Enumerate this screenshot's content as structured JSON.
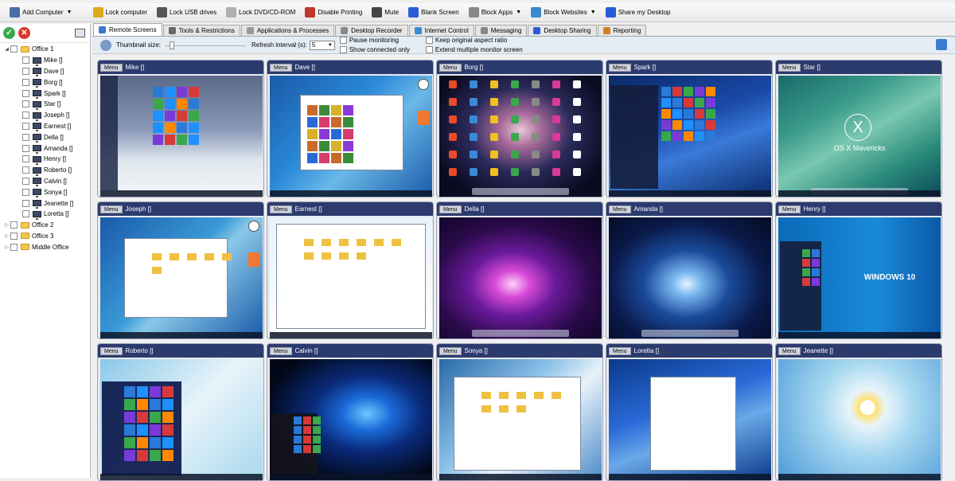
{
  "toolbar": {
    "items": [
      {
        "label": "Add Computer",
        "icon": "add-computer-icon",
        "color": "#4a6ea8"
      },
      {
        "label": "Lock computer",
        "icon": "lock-icon",
        "color": "#e0a820"
      },
      {
        "label": "Lock USB drives",
        "icon": "usb-icon",
        "color": "#555555"
      },
      {
        "label": "Lock DVD/CD-ROM",
        "icon": "dvd-icon",
        "color": "#b0b0b0"
      },
      {
        "label": "Disable Printing",
        "icon": "printer-icon",
        "color": "#c0392b"
      },
      {
        "label": "Mute",
        "icon": "speaker-icon",
        "color": "#444444"
      },
      {
        "label": "Blank Screen",
        "icon": "monitor-icon",
        "color": "#2a5bd7"
      },
      {
        "label": "Block Apps",
        "icon": "block-apps-icon",
        "color": "#888888"
      },
      {
        "label": "Block Websites",
        "icon": "globe-icon",
        "color": "#3a8ad0"
      },
      {
        "label": "Share my Desktop",
        "icon": "share-desktop-icon",
        "color": "#2a5bd7"
      }
    ]
  },
  "sidebar": {
    "tree": [
      {
        "label": "Office 1",
        "type": "folder",
        "expanded": true,
        "children": [
          "Mike []",
          "Dave []",
          "Borg []",
          "Spark []",
          "Star []",
          "Joseph []",
          "Earnest []",
          "Della []",
          "Amanda []",
          "Henry []",
          "Roberto []",
          "Calvin []",
          "Sonya []",
          "Jeanette []",
          "Loretta []"
        ]
      },
      {
        "label": "Office 2",
        "type": "folder",
        "expanded": false
      },
      {
        "label": "Office 3",
        "type": "folder",
        "expanded": false
      },
      {
        "label": "Middle Office",
        "type": "folder",
        "expanded": false
      }
    ]
  },
  "tabs": [
    {
      "label": "Remote Screens",
      "active": true,
      "color": "#3a7ad0"
    },
    {
      "label": "Tools & Restrictions",
      "active": false,
      "color": "#666666"
    },
    {
      "label": "Applications & Processes",
      "active": false,
      "color": "#999999"
    },
    {
      "label": "Desktop Recorder",
      "active": false,
      "color": "#888888"
    },
    {
      "label": "Internet Control",
      "active": false,
      "color": "#3a8ad0"
    },
    {
      "label": "Messaging",
      "active": false,
      "color": "#888888"
    },
    {
      "label": "Desktop Sharing",
      "active": false,
      "color": "#2a5bd7"
    },
    {
      "label": "Reporting",
      "active": false,
      "color": "#d08020"
    }
  ],
  "options": {
    "thumbnail_label": "Thumbnail size:",
    "thumbnail_value": 0.05,
    "refresh_label": "Refresh interval (s):",
    "refresh_value": "5",
    "checkboxes": [
      "Pause monitoring",
      "Show connected only",
      "Keep original aspect ratio",
      "Extend multiple monitor screen"
    ]
  },
  "menu_label": "Menu",
  "screens": [
    {
      "name": "Mike []",
      "theme": "win10-snow"
    },
    {
      "name": "Dave []",
      "theme": "win7-dialog"
    },
    {
      "name": "Borg []",
      "theme": "mac-galaxy-icons"
    },
    {
      "name": "Spark []",
      "theme": "win10-blue-start"
    },
    {
      "name": "Star []",
      "theme": "osx-mavericks",
      "overlay": "OS X Mavericks"
    },
    {
      "name": "Joseph []",
      "theme": "win7-explorer"
    },
    {
      "name": "Earnest []",
      "theme": "win8-explorer"
    },
    {
      "name": "Della []",
      "theme": "mac-purple"
    },
    {
      "name": "Amanda []",
      "theme": "mac-blue-burst"
    },
    {
      "name": "Henry []",
      "theme": "win10-blue",
      "overlay": "WINDOWS 10"
    },
    {
      "name": "Roberto []",
      "theme": "win10-start-menu"
    },
    {
      "name": "Calvin []",
      "theme": "win10-dark"
    },
    {
      "name": "Sonya []",
      "theme": "win8-explorer-light"
    },
    {
      "name": "Loretta []",
      "theme": "win7-wizard"
    },
    {
      "name": "Jeanette []",
      "theme": "win8-daisy"
    }
  ]
}
